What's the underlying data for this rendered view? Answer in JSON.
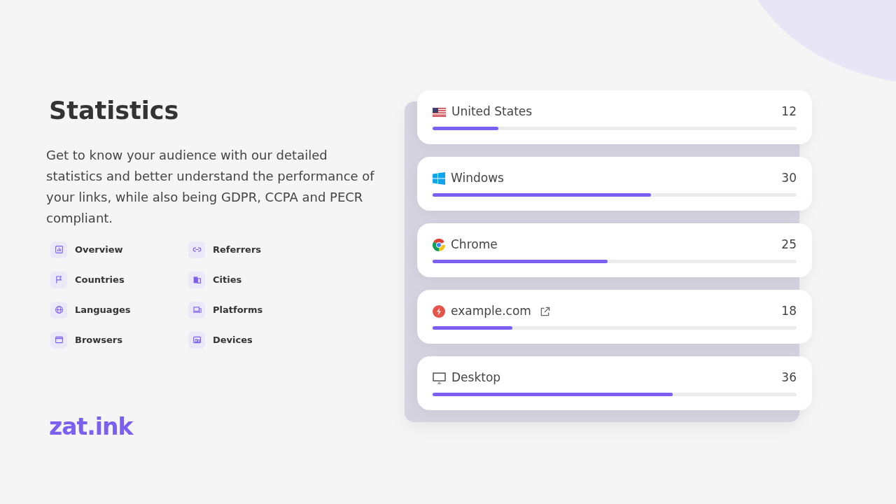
{
  "heading": "Statistics",
  "description": "Get to know your audience with our detailed statistics and better understand the performance of your links, while also being GDPR, CCPA and PECR compliant.",
  "features": [
    {
      "label": "Overview",
      "kind": "chart"
    },
    {
      "label": "Referrers",
      "kind": "link"
    },
    {
      "label": "Countries",
      "kind": "flag"
    },
    {
      "label": "Cities",
      "kind": "building"
    },
    {
      "label": "Languages",
      "kind": "globe"
    },
    {
      "label": "Platforms",
      "kind": "laptop"
    },
    {
      "label": "Browsers",
      "kind": "window"
    },
    {
      "label": "Devices",
      "kind": "devices"
    }
  ],
  "logo": "zat.ink",
  "stats": [
    {
      "kind": "country",
      "label": "United States",
      "count": "12",
      "level": 0.18
    },
    {
      "kind": "platform",
      "label": "Windows",
      "count": "30",
      "level": 0.6
    },
    {
      "kind": "browser",
      "label": "Chrome",
      "count": "25",
      "level": 0.48
    },
    {
      "kind": "referrer",
      "label": "example.com",
      "count": "18",
      "level": 0.22
    },
    {
      "kind": "device",
      "label": "Desktop",
      "count": "36",
      "level": 0.66
    }
  ]
}
